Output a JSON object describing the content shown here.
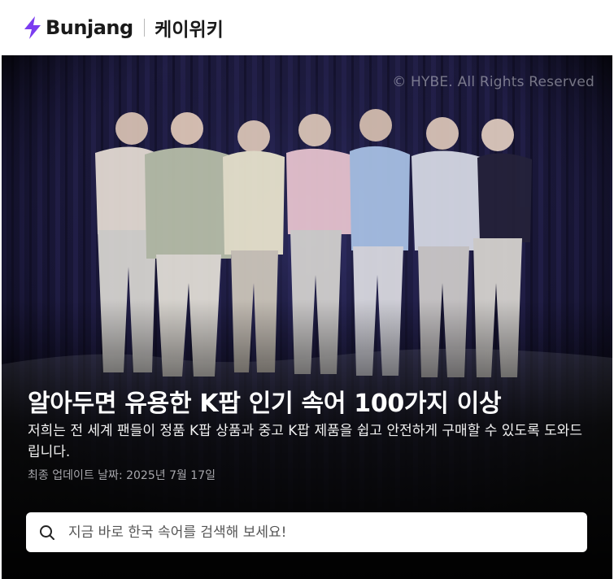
{
  "header": {
    "logo_text": "Bunjang",
    "wiki_title": "케이위키",
    "brand_color": "#7b3df0"
  },
  "hero": {
    "copyright": "© HYBE. All Rights Reserved",
    "title": "알아두면 유용한 K팝 인기 속어 100가지 이상",
    "description": "저희는 전 세계 팬들이 정품 K팝 상품과 중고 K팝 제품을 쉽고 안전하게 구매할 수 있도록 도와드립니다.",
    "updated": "최종 업데이트 날짜: 2025년 7월 17일"
  },
  "search": {
    "placeholder": "지금 바로 한국 속어를 검색해 보세요!",
    "value": "",
    "icon": "search-icon"
  }
}
